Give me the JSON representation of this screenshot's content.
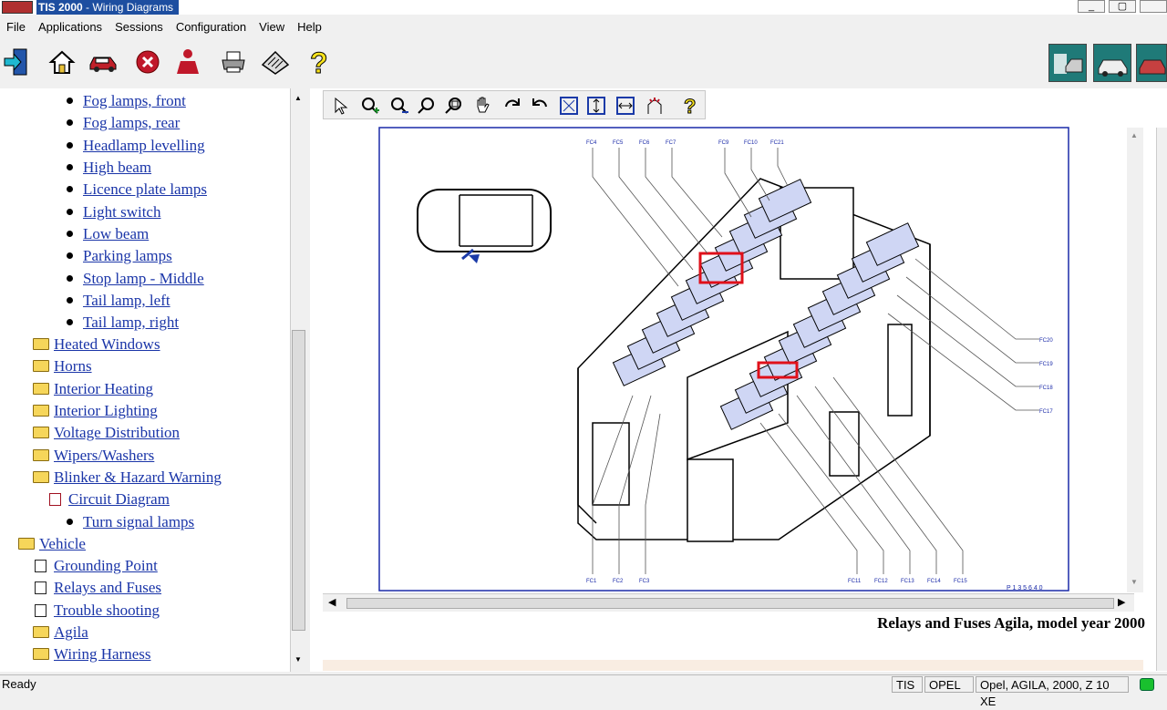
{
  "window": {
    "app_name": "TIS 2000",
    "title_suffix": "- Wiring Diagrams"
  },
  "menu": [
    "File",
    "Applications",
    "Sessions",
    "Configuration",
    "View",
    "Help"
  ],
  "toolbar_icons": [
    "exit-icon",
    "home-icon",
    "vehicle-icon",
    "stop-icon",
    "user-icon",
    "print-icon",
    "notes-icon",
    "help-icon"
  ],
  "tree": {
    "sub_items": [
      "Fog lamps, front",
      "Fog lamps, rear",
      "Headlamp levelling",
      "High beam",
      "Licence plate lamps",
      "Light switch",
      "Low beam",
      "Parking lamps",
      "Stop lamp - Middle",
      "Tail lamp, left",
      "Tail lamp, right"
    ],
    "folders_a": [
      "Heated Windows",
      "Horns",
      "Interior Heating",
      "Interior Lighting",
      "Voltage Distribution",
      "Wipers/Washers",
      "Blinker & Hazard Warning"
    ],
    "circuit_diagram": "Circuit Diagram",
    "turn_signal": "Turn signal lamps",
    "vehicle": "Vehicle",
    "vehicle_children": [
      "Grounding Point",
      "Relays and Fuses",
      "Trouble shooting",
      "Agila",
      "Wiring Harness"
    ]
  },
  "diagram": {
    "caption": "Relays and Fuses Agila, model year 2000",
    "ref_code": "P 1 3 5 6 4 0",
    "top_labels": [
      "FC4",
      "FC5",
      "FC6",
      "FC7",
      "FC9",
      "FC10",
      "FC21"
    ],
    "right_labels": [
      "FC20",
      "FC19",
      "FC18",
      "FC17"
    ],
    "bottom_labels": [
      "FC1",
      "FC2",
      "FC3",
      "FC11",
      "FC12",
      "FC13",
      "FC14",
      "FC15"
    ]
  },
  "status": {
    "ready": "Ready",
    "cells": [
      "TIS",
      "OPEL",
      "Opel, AGILA, 2000, Z 10 XE"
    ]
  }
}
